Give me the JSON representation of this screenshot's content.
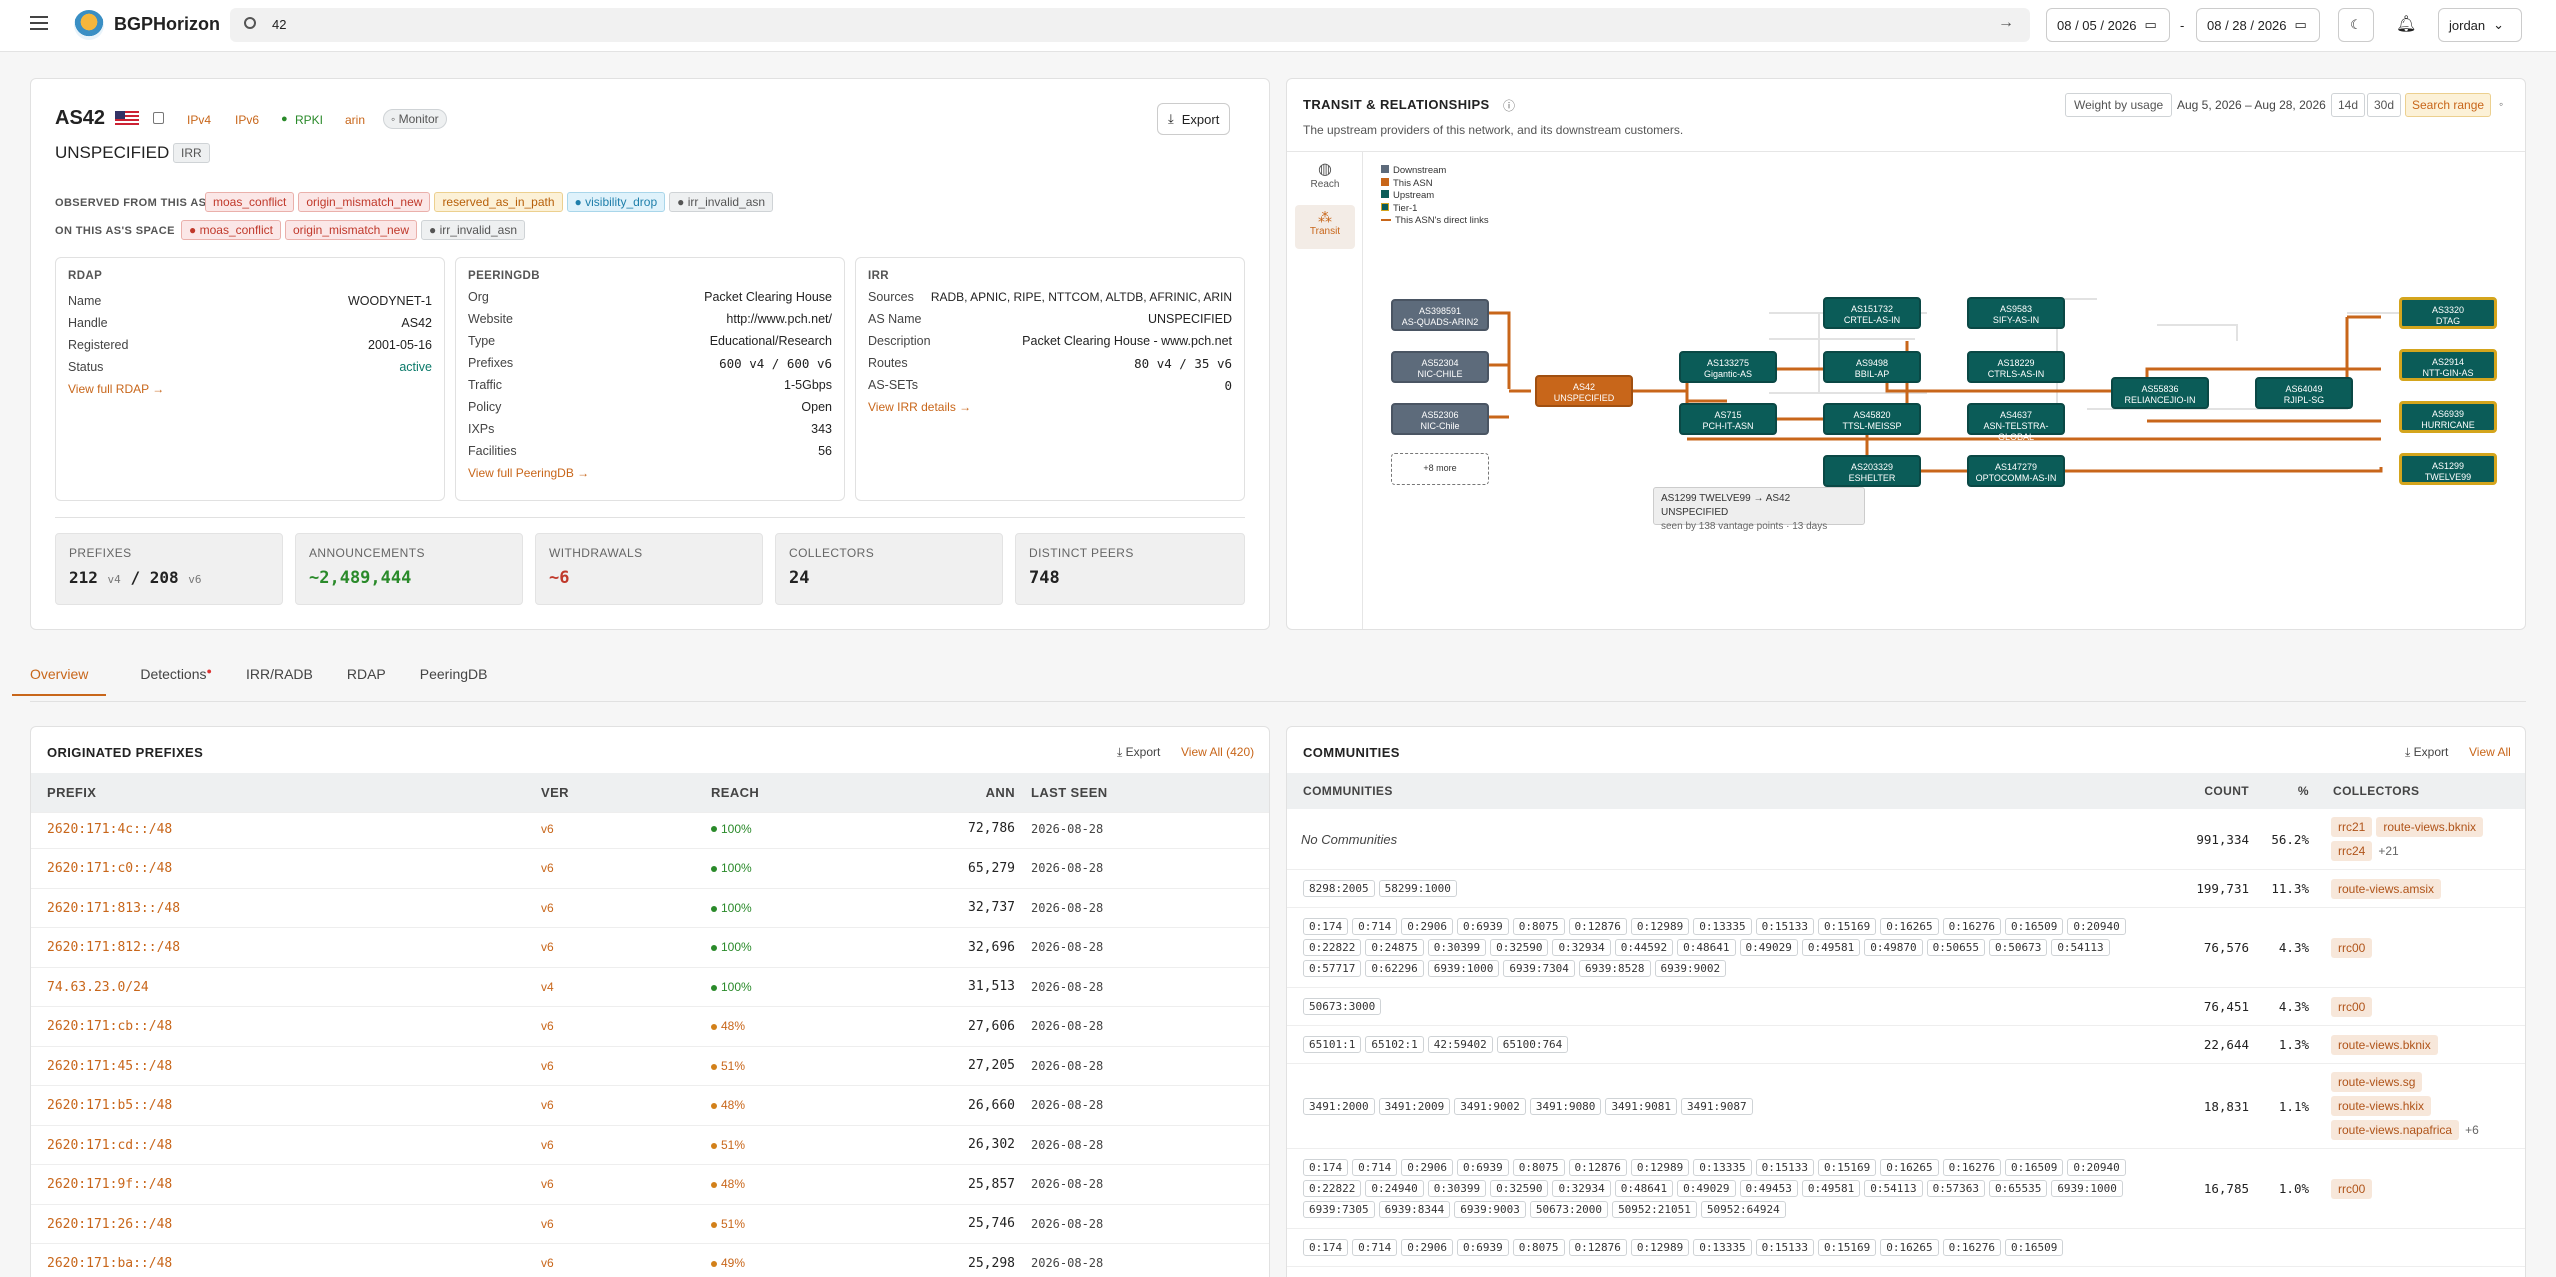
{
  "app": {
    "brand": "BGPHorizon",
    "search_value": "42",
    "date_from": "08 / 05 / 2026",
    "date_to": "08 / 28 / 2026",
    "date_sep": "-",
    "user": "jordan"
  },
  "asn": {
    "title": "AS42",
    "name": "UNSPECIFIED",
    "irr_badge": "IRR",
    "badges": [
      "IPv4",
      "IPv6",
      "RPKI",
      "arin",
      "Monitor"
    ],
    "export_label": "Export",
    "observed_label": "OBSERVED FROM THIS AS",
    "observed_tags": [
      "moas_conflict",
      "origin_mismatch_new",
      "reserved_as_in_path",
      "visibility_drop",
      "irr_invalid_asn"
    ],
    "space_label": "ON THIS AS'S SPACE",
    "space_tags": [
      "moas_conflict",
      "origin_mismatch_new",
      "irr_invalid_asn"
    ]
  },
  "rdap": {
    "title": "RDAP",
    "rows": [
      [
        "Name",
        "WOODYNET-1"
      ],
      [
        "Handle",
        "AS42"
      ],
      [
        "Registered",
        "2001-05-16"
      ],
      [
        "Status",
        "active"
      ]
    ],
    "link": "View full RDAP →"
  },
  "peeringdb": {
    "title": "PEERINGDB",
    "rows": [
      [
        "Org",
        "Packet Clearing House"
      ],
      [
        "Website",
        "http://www.pch.net/"
      ],
      [
        "Type",
        "Educational/Research"
      ],
      [
        "Prefixes",
        "600 v4 / 600 v6"
      ],
      [
        "Traffic",
        "1-5Gbps"
      ],
      [
        "Policy",
        "Open"
      ],
      [
        "IXPs",
        "343"
      ],
      [
        "Facilities",
        "56"
      ]
    ],
    "link": "View full PeeringDB →"
  },
  "irr": {
    "title": "IRR",
    "rows": [
      [
        "Sources",
        "RADB, APNIC, RIPE, NTTCOM, ALTDB, AFRINIC, ARIN"
      ],
      [
        "AS Name",
        "UNSPECIFIED"
      ],
      [
        "Description",
        "Packet Clearing House - www.pch.net"
      ],
      [
        "Routes",
        "80 v4 / 35 v6"
      ],
      [
        "AS-SETs",
        "0"
      ]
    ],
    "link": "View IRR details →"
  },
  "stats": [
    {
      "label": "PREFIXES",
      "v4": "212",
      "v4u": "v4",
      "sep": "/",
      "v6": "208",
      "v6u": "v6"
    },
    {
      "label": "ANNOUNCEMENTS",
      "value": "~2,489,444"
    },
    {
      "label": "WITHDRAWALS",
      "value": "~6"
    },
    {
      "label": "COLLECTORS",
      "value": "24"
    },
    {
      "label": "DISTINCT PEERS",
      "value": "748"
    }
  ],
  "transit": {
    "title": "TRANSIT & RELATIONSHIPS",
    "subtitle": "The upstream providers of this network, and its downstream customers.",
    "weight": "Weight by usage",
    "range": "Aug 5, 2026 – Aug 28, 2026",
    "ranges": [
      "14d",
      "30d",
      "Search range"
    ],
    "side": [
      "Reach",
      "Transit"
    ],
    "legend": [
      "Downstream",
      "This ASN",
      "Upstream",
      "Tier-1",
      "This ASN's direct links"
    ],
    "tooltip_title": "AS1299 TWELVE99 → AS42 UNSPECIFIED",
    "tooltip_sub": "seen by 138 vantage points · 13 days",
    "nodes": [
      [
        "AS398591",
        "AS-QUADS-ARIN2"
      ],
      [
        "AS52304",
        "NIC-CHILE"
      ],
      [
        "AS52306",
        "NIC-Chile"
      ],
      [
        "+8 more",
        ""
      ],
      [
        "AS42",
        "UNSPECIFIED"
      ],
      [
        "AS133275",
        "Gigantic-AS"
      ],
      [
        "AS715",
        "PCH-IT-ASN"
      ],
      [
        "AS151732",
        "CRTEL-AS-IN"
      ],
      [
        "AS9498",
        "BBIL-AP"
      ],
      [
        "AS45820",
        "TTSL-MEISSP"
      ],
      [
        "AS203329",
        "ESHELTER"
      ],
      [
        "AS9583",
        "SIFY-AS-IN"
      ],
      [
        "AS18229",
        "CTRLS-AS-IN"
      ],
      [
        "AS4637",
        "ASN-TELSTRA-GLOBAL"
      ],
      [
        "AS147279",
        "OPTOCOMM-AS-IN"
      ],
      [
        "AS55836",
        "RELIANCEJIO-IN"
      ],
      [
        "AS64049",
        "RJIPL-SG"
      ],
      [
        "AS3320",
        "DTAG"
      ],
      [
        "AS2914",
        "NTT-GIN-AS"
      ],
      [
        "AS6939",
        "HURRICANE"
      ],
      [
        "AS1299",
        "TWELVE99"
      ]
    ]
  },
  "tabs": [
    "Overview",
    "Detections",
    "IRR/RADB",
    "RDAP",
    "PeeringDB"
  ],
  "prefixes": {
    "title": "ORIGINATED PREFIXES",
    "export": "Export",
    "view_all": "View All (420)",
    "headers": [
      "PREFIX",
      "VER",
      "REACH",
      "ANN",
      "LAST SEEN"
    ],
    "rows": [
      [
        "2620:171:4c::/48",
        "v6",
        "100%",
        "72,786",
        "2026-08-28"
      ],
      [
        "2620:171:c0::/48",
        "v6",
        "100%",
        "65,279",
        "2026-08-28"
      ],
      [
        "2620:171:813::/48",
        "v6",
        "100%",
        "32,737",
        "2026-08-28"
      ],
      [
        "2620:171:812::/48",
        "v6",
        "100%",
        "32,696",
        "2026-08-28"
      ],
      [
        "74.63.23.0/24",
        "v4",
        "100%",
        "31,513",
        "2026-08-28"
      ],
      [
        "2620:171:cb::/48",
        "v6",
        "48%",
        "27,606",
        "2026-08-28"
      ],
      [
        "2620:171:45::/48",
        "v6",
        "51%",
        "27,205",
        "2026-08-28"
      ],
      [
        "2620:171:b5::/48",
        "v6",
        "48%",
        "26,660",
        "2026-08-28"
      ],
      [
        "2620:171:cd::/48",
        "v6",
        "51%",
        "26,302",
        "2026-08-28"
      ],
      [
        "2620:171:9f::/48",
        "v6",
        "48%",
        "25,857",
        "2026-08-28"
      ],
      [
        "2620:171:26::/48",
        "v6",
        "51%",
        "25,746",
        "2026-08-28"
      ],
      [
        "2620:171:ba::/48",
        "v6",
        "49%",
        "25,298",
        "2026-08-28"
      ]
    ]
  },
  "communities": {
    "title": "COMMUNITIES",
    "export": "Export",
    "view_all": "View All",
    "headers": [
      "COMMUNITIES",
      "COUNT",
      "%",
      "COLLECTORS"
    ],
    "rows": [
      {
        "none": "No Communities",
        "comms": [],
        "count": "991,334",
        "pct": "56.2%",
        "cols": [
          "rrc21",
          "route-views.bknix",
          "rrc24"
        ],
        "more": "+21"
      },
      {
        "comms": [
          "8298:2005",
          "58299:1000"
        ],
        "count": "199,731",
        "pct": "11.3%",
        "cols": [
          "route-views.amsix"
        ]
      },
      {
        "comms": [
          "0:174",
          "0:714",
          "0:2906",
          "0:6939",
          "0:8075",
          "0:12876",
          "0:12989",
          "0:13335",
          "0:15133",
          "0:15169",
          "0:16265",
          "0:16276",
          "0:16509",
          "0:20940",
          "0:22822",
          "0:24875",
          "0:30399",
          "0:32590",
          "0:32934",
          "0:44592",
          "0:48641",
          "0:49029",
          "0:49581",
          "0:49870",
          "0:50655",
          "0:50673",
          "0:54113",
          "0:57717",
          "0:62296",
          "6939:1000",
          "6939:7304",
          "6939:8528",
          "6939:9002"
        ],
        "count": "76,576",
        "pct": "4.3%",
        "cols": [
          "rrc00"
        ]
      },
      {
        "comms": [
          "50673:3000"
        ],
        "count": "76,451",
        "pct": "4.3%",
        "cols": [
          "rrc00"
        ]
      },
      {
        "comms": [
          "65101:1",
          "65102:1",
          "42:59402",
          "65100:764"
        ],
        "count": "22,644",
        "pct": "1.3%",
        "cols": [
          "route-views.bknix"
        ]
      },
      {
        "comms": [
          "3491:2000",
          "3491:2009",
          "3491:9002",
          "3491:9080",
          "3491:9081",
          "3491:9087"
        ],
        "count": "18,831",
        "pct": "1.1%",
        "cols": [
          "route-views.sg",
          "route-views.hkix",
          "route-views.napafrica"
        ],
        "more": "+6"
      },
      {
        "comms": [
          "0:174",
          "0:714",
          "0:2906",
          "0:6939",
          "0:8075",
          "0:12876",
          "0:12989",
          "0:13335",
          "0:15133",
          "0:15169",
          "0:16265",
          "0:16276",
          "0:16509",
          "0:20940",
          "0:22822",
          "0:24940",
          "0:30399",
          "0:32590",
          "0:32934",
          "0:48641",
          "0:49029",
          "0:49453",
          "0:49581",
          "0:54113",
          "0:57363",
          "0:65535",
          "6939:1000",
          "6939:7305",
          "6939:8344",
          "6939:9003",
          "50673:2000",
          "50952:21051",
          "50952:64924"
        ],
        "count": "16,785",
        "pct": "1.0%",
        "cols": [
          "rrc00"
        ]
      },
      {
        "comms": [
          "0:174",
          "0:714",
          "0:2906",
          "0:6939",
          "0:8075",
          "0:12876",
          "0:12989",
          "0:13335",
          "0:15133",
          "0:15169",
          "0:16265",
          "0:16276",
          "0:16509"
        ],
        "count": "",
        "pct": "",
        "cols": []
      }
    ]
  }
}
